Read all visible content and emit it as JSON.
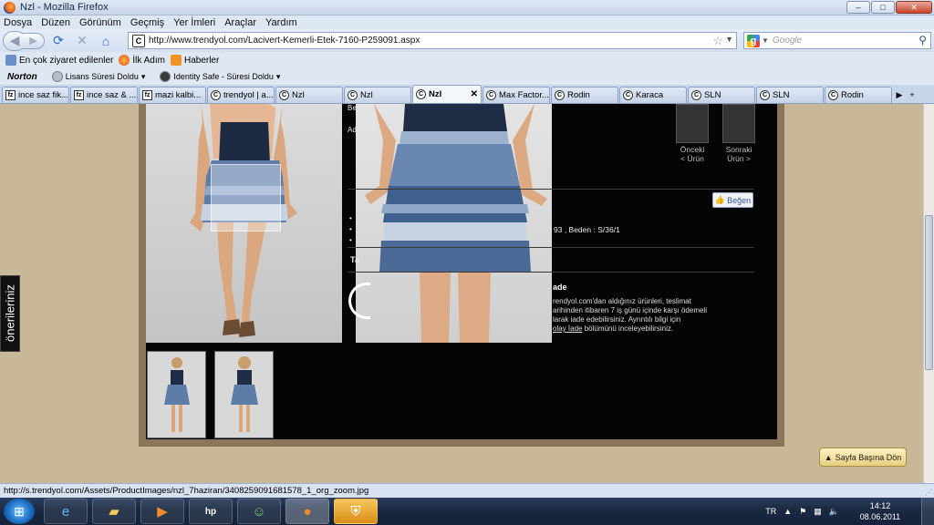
{
  "window": {
    "title": "Nzl - Mozilla Firefox",
    "buttons": [
      "–",
      "□",
      "✕"
    ]
  },
  "menu": [
    "Dosya",
    "Düzen",
    "Görünüm",
    "Geçmiş",
    "Yer İmleri",
    "Araçlar",
    "Yardım"
  ],
  "nav": {
    "url": "http://www.trendyol.com/Lacivert-Kemerli-Etek-7160-P259091.aspx",
    "search_placeholder": "Google"
  },
  "bookmarks": [
    "En çok ziyaret edilenler",
    "İlk Adım",
    "Haberler"
  ],
  "norton": {
    "logo": "Norton",
    "items": [
      "Lisans Süresi Doldu",
      "Identity Safe - Süresi Doldu"
    ]
  },
  "tabs": [
    {
      "label": "ince saz fik...",
      "icon": "fz"
    },
    {
      "label": "ince saz & ...",
      "icon": "fz"
    },
    {
      "label": "mazi kalbi...",
      "icon": "fz"
    },
    {
      "label": "trendyol | a...",
      "icon": "C"
    },
    {
      "label": "Nzl",
      "icon": "C"
    },
    {
      "label": "Nzl",
      "icon": "C"
    },
    {
      "label": "Nzl",
      "icon": "C",
      "active": true
    },
    {
      "label": "Max Factor...",
      "icon": "C"
    },
    {
      "label": "Rodin",
      "icon": "C"
    },
    {
      "label": "Karaca",
      "icon": "C"
    },
    {
      "label": "SLN",
      "icon": "C"
    },
    {
      "label": "SLN",
      "icon": "C"
    },
    {
      "label": "Rodin",
      "icon": "C"
    }
  ],
  "page": {
    "prev_label": "Önceki",
    "prev_sub": "< Ürün",
    "next_label": "Sonraki",
    "next_sub": "Ürün >",
    "like": "Beğen",
    "size_text": "93 , Beden : S/36/1",
    "kargo_head": "ade",
    "kargo_line1": "rendyol.com'dan aldığınız ürünleri, teslimat",
    "kargo_line2": "arihinden itibaren 7 iş günü içinde karşı ödemeli",
    "kargo_line3": "larak iade edebilirsiniz. Ayrıntılı bilgi için",
    "kargo_link": "olay İade",
    "kargo_line4_rest": " bölümünü inceleyebilirsiniz.",
    "side_tab": "önerileriniz",
    "top_button": "Sayfa Başına Dön",
    "frag_be": "Be",
    "frag_ad": "Ad",
    "frag_ta": "Ta"
  },
  "status": "http://s.trendyol.com/Assets/ProductImages/nzl_7haziran/3408259091681578_1_org_zoom.jpg",
  "taskbar": {
    "lang": "TR",
    "time": "14:12",
    "date": "08.06.2011"
  }
}
